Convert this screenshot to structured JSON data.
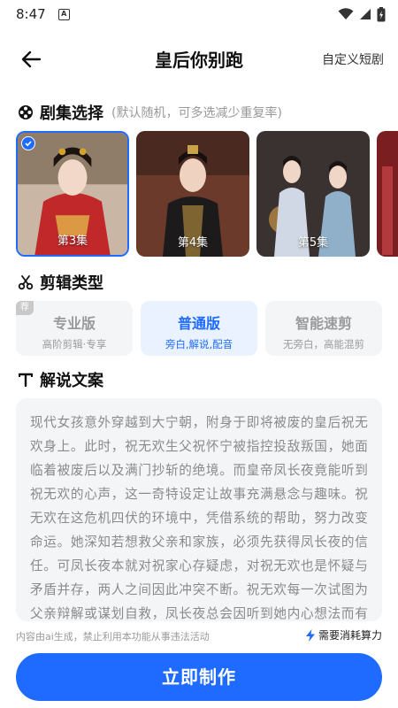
{
  "status_bar": {
    "time": "8:47",
    "a_icon": "A"
  },
  "header": {
    "title": "皇后你别跑",
    "custom_label": "自定义短剧"
  },
  "episodes_section": {
    "label": "剧集选择",
    "hint": "(默认随机，可多选减少重复率)",
    "episodes": [
      {
        "label": "第3集",
        "selected": true
      },
      {
        "label": "第4集",
        "selected": false
      },
      {
        "label": "第5集",
        "selected": false
      }
    ]
  },
  "edit_section": {
    "label": "剪辑类型",
    "types": [
      {
        "tag": "荐",
        "name": "专业版",
        "desc": "高阶剪辑·专享",
        "active": false
      },
      {
        "name": "普通版",
        "desc": "旁白,解说,配音",
        "active": true
      },
      {
        "name": "智能速剪",
        "desc": "无旁白，高能混剪",
        "active": false
      }
    ]
  },
  "script_section": {
    "label": "解说文案",
    "text": "现代女孩意外穿越到大宁朝，附身于即将被废的皇后祝无欢身上。此时，祝无欢生父祝怀宁被指控投敌叛国，她面临着被废后以及满门抄斩的绝境。而皇帝凤长夜竟能听到祝无欢的心声，这一奇特设定让故事充满悬念与趣味。祝无欢在这危机四伏的环境中，凭借系统的帮助，努力改变命运。她深知若想救父亲和家族，必须先获得凤长夜的信任。可凤长夜本就对祝家心存疑虑，对祝无欢也是怀疑与矛盾并存，两人之间因此冲突不断。祝无欢每一次试图为父亲辩解或谋划自救，凤长夜总会因听到她内心想法而有所警惕，这"
  },
  "footer": {
    "note": "内容由ai生成，禁止利用本功能从事违法活动",
    "cost": "需要消耗算力",
    "make_button": "立即制作"
  },
  "colors": {
    "accent": "#1f6bff",
    "card_bg": "#f4f5f7"
  }
}
